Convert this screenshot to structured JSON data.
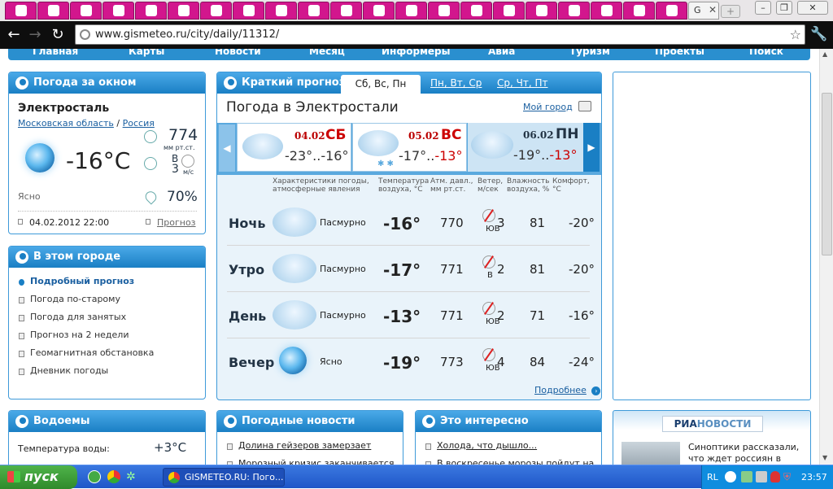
{
  "browser": {
    "tabs": [
      "",
      "",
      "",
      "",
      "",
      "",
      "",
      "",
      "",
      "",
      "",
      "",
      "",
      "",
      "",
      "",
      "",
      "",
      "",
      "",
      ""
    ],
    "active_tab_label": "G",
    "url": "www.gismeteo.ru/city/daily/11312/"
  },
  "menu": {
    "items": [
      "Главная",
      "Карты",
      "Новости",
      "Месяц",
      "Информеры",
      "Авиа",
      "Туризм",
      "Проекты",
      "Поиск"
    ]
  },
  "now": {
    "header": "Погода за окном",
    "city": "Электросталь",
    "region": "Московская область",
    "separator": "/",
    "country": "Россия",
    "temp": "-16°C",
    "pressure": "774",
    "pressure_unit": "мм рт.ст.",
    "wind_dir": "В",
    "wind_speed": "3",
    "wind_unit": "м/с",
    "condition": "Ясно",
    "humidity": "70%",
    "datetime": "04.02.2012 22:00",
    "forecast_link": "Прогноз"
  },
  "city_box": {
    "header": "В этом городе",
    "items": [
      "Подробный прогноз",
      "Погода по-старому",
      "Погода для занятых",
      "Прогноз на 2 недели",
      "Геомагнитная обстановка",
      "Дневник погоды"
    ]
  },
  "short": {
    "header": "Краткий прогноз:",
    "tab_active": "Сб, Вс, Пн",
    "tab2": "Пн, Вт, Ср",
    "tab3": "Ср, Чт, Пт",
    "title": "Погода в Электростали",
    "my_city": "Мой город",
    "days": [
      {
        "date": "04.02",
        "name": "СБ",
        "low": "-23°",
        "sep": "..",
        "high": "-16°"
      },
      {
        "date": "05.02",
        "name": "ВС",
        "low": "-17°",
        "sep": "..",
        "high": "-13°"
      },
      {
        "date": "06.02",
        "name": "ПН",
        "low": "-19°",
        "sep": "..",
        "high": "-13°"
      }
    ],
    "col_headers": {
      "phen": "Характеристики погоды, атмосферные явления",
      "temp": "Температура воздуха, °С",
      "press": "Атм. давл., мм рт.ст.",
      "wind": "Ветер, м/сек",
      "hum": "Влажность воздуха, %",
      "comf": "Комфорт, °С"
    },
    "rows": [
      {
        "name": "Ночь",
        "phen": "Пасмурно",
        "temp": "-16°",
        "press": "770",
        "dir": "ЮВ",
        "wind": "3",
        "hum": "81",
        "comf": "-20°",
        "icon": "cloud"
      },
      {
        "name": "Утро",
        "phen": "Пасмурно",
        "temp": "-17°",
        "press": "771",
        "dir": "В",
        "wind": "2",
        "hum": "81",
        "comf": "-20°",
        "icon": "cloud"
      },
      {
        "name": "День",
        "phen": "Пасмурно",
        "temp": "-13°",
        "press": "771",
        "dir": "ЮВ",
        "wind": "2",
        "hum": "71",
        "comf": "-16°",
        "icon": "cloud"
      },
      {
        "name": "Вечер",
        "phen": "Ясно",
        "temp": "-19°",
        "press": "773",
        "dir": "ЮВ",
        "wind": "4",
        "hum": "84",
        "comf": "-24°",
        "icon": "moon"
      }
    ],
    "more": "Подробнее"
  },
  "water": {
    "header": "Водоемы",
    "label": "Температура воды:",
    "value": "+3°C"
  },
  "news": {
    "header": "Погодные новости",
    "items": [
      "Долина гейзеров замерзает",
      "Морозный кризис заканчивается"
    ]
  },
  "interesting": {
    "header": "Это интересно",
    "items": [
      "Холода, что дышло...",
      "В воскресенье морозы пойдут на"
    ]
  },
  "ria": {
    "logo1": "РИА",
    "logo2": "НОВОСТИ",
    "text1": "Синоптики рассказали,",
    "text2": "что ждет россиян в"
  },
  "taskbar": {
    "start": "пуск",
    "window": "GISMETEO.RU: Пого...",
    "lang": "RL",
    "clock": "23:57"
  },
  "colors": {
    "accent": "#1a7fc4",
    "tab_pink": "#d2168d",
    "temp_red": "#c00"
  }
}
